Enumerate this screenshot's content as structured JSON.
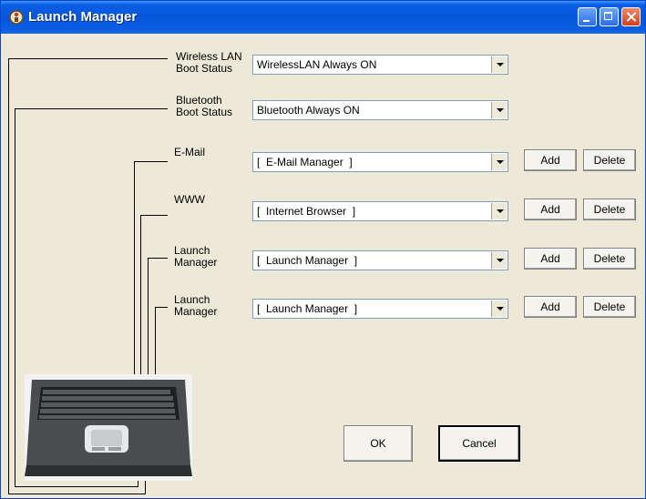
{
  "window": {
    "title": "Launch Manager",
    "icon": "launch-manager-app-icon"
  },
  "rows": [
    {
      "label": "Wireless LAN\nBoot Status",
      "value": "WirelessLAN Always ON"
    },
    {
      "label": "Bluetooth\nBoot Status",
      "value": "Bluetooth Always ON"
    },
    {
      "label": "E-Mail",
      "value": "[  E-Mail Manager  ]",
      "add": "Add",
      "delete": "Delete"
    },
    {
      "label": "WWW",
      "value": "[  Internet Browser  ]",
      "add": "Add",
      "delete": "Delete"
    },
    {
      "label": "Launch\nManager",
      "value": "[  Launch Manager  ]",
      "add": "Add",
      "delete": "Delete"
    },
    {
      "label": "Launch\nManager",
      "value": "[  Launch Manager  ]",
      "add": "Add",
      "delete": "Delete"
    }
  ],
  "buttons": {
    "ok": "OK",
    "cancel": "Cancel"
  },
  "colors": {
    "titlebar": "#0655d8",
    "window": "#ece9d8"
  }
}
